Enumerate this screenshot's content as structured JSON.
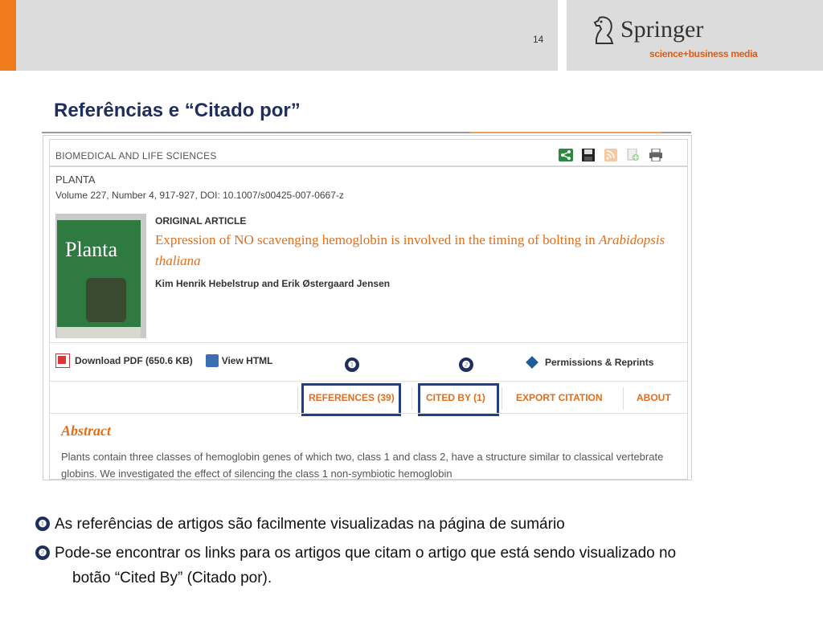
{
  "header": {
    "page_number": "14",
    "logo_name": "Springer",
    "logo_tagline": "science+business media"
  },
  "slide": {
    "title": "Referências e “Citado por”"
  },
  "screenshot": {
    "subject": "BIOMEDICAL AND LIFE SCIENCES",
    "journal": "PLANTA",
    "volume": "Volume 227, Number 4, 917-927, DOI: 10.1007/s00425-007-0667-z",
    "cover_word": "Planta",
    "article_type": "ORIGINAL ARTICLE",
    "article_title_main": "Expression of NO scavenging hemoglobin is involved in the timing of bolting in ",
    "article_title_species": "Arabidopsis thaliana",
    "authors": "Kim Henrik Hebelstrup and Erik Østergaard Jensen",
    "download_pdf": "Download PDF (650.6 KB)",
    "view_html": "View HTML",
    "permissions": "Permissions & Reprints",
    "tabs": {
      "references": "REFERENCES (39)",
      "cited_by": "CITED BY (1)",
      "export": "EXPORT CITATION",
      "about": "ABOUT"
    },
    "abstract_heading": "Abstract",
    "abstract_text": "Plants contain three classes of hemoglobin genes of which two, class 1 and class 2, have a structure similar to classical vertebrate globins. We investigated the effect of silencing the class 1 non-symbiotic hemoglobin",
    "icons": [
      "share-icon",
      "save-icon",
      "rss-icon",
      "add-icon",
      "print-icon"
    ]
  },
  "markers": {
    "one": "❶",
    "two": "❷"
  },
  "notes": [
    {
      "marker": "❶",
      "text": "As referências de artigos são facilmente visualizadas na página de sumário"
    },
    {
      "marker": "❷",
      "text_line1": "Pode-se encontrar os links para os artigos que citam o artigo que está sendo visualizado no",
      "text_line2": "botão “Cited By” (Citado por)."
    }
  ],
  "colors": {
    "accent_orange": "#f07c1e",
    "link_orange": "#e06e1a",
    "title_navy": "#1f2f5c",
    "highlight_blue": "#1f3f8a"
  }
}
